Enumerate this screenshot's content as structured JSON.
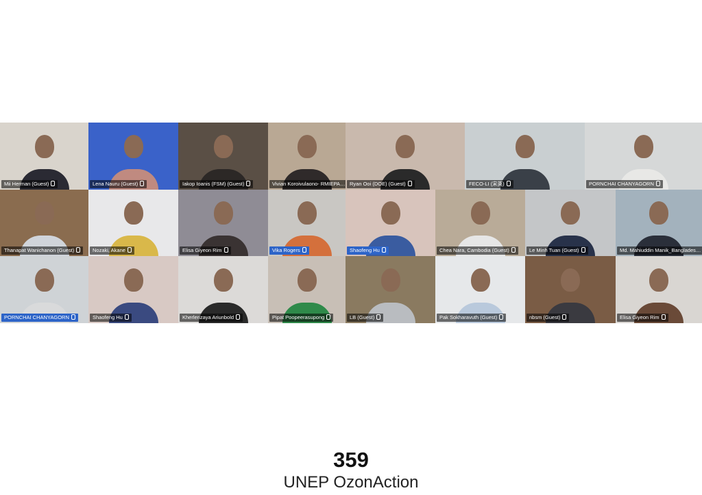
{
  "tiles": [
    {
      "name": "Mii Herman (Guest)",
      "bg": "#d9d4cc",
      "body": "#2a2a33",
      "label": "dark"
    },
    {
      "name": "Lena Nauru (Guest)",
      "bg": "#3a62c9",
      "body": "#c08a80",
      "label": "dark"
    },
    {
      "name": "Iakop Ioanis (FSM) (Guest)",
      "bg": "#5a4f45",
      "body": "#2c2826",
      "label": "dark"
    },
    {
      "name": "Vivian Koroivulaono- RMIEPA",
      "bg": "#b9a894",
      "body": "#2f2a2a",
      "label": "dark"
    },
    {
      "name": "Ryan Ooi (DOE) (Guest)",
      "bg": "#c9b9ad",
      "body": "#2a2a2a",
      "label": "dark"
    },
    {
      "name": "FECO-LI (宋英)",
      "bg": "#c9cfd1",
      "body": "#3a4048",
      "label": "dark"
    },
    {
      "name": "PORNCHAI CHANYAGORN",
      "bg": "#d6d8d8",
      "body": "#e8e8e6",
      "label": "dark"
    },
    {
      "name": "Thanapat Wanichanon (Guest)",
      "bg": "#8a6c4f",
      "body": "#d0d4da",
      "label": "dark"
    },
    {
      "name": "Nozaki, Akane",
      "bg": "#e8e8ea",
      "body": "#d9b84a",
      "label": "dark"
    },
    {
      "name": "Elisa Giyeon Rim",
      "bg": "#8f8c95",
      "body": "#3a3333",
      "label": "dark"
    },
    {
      "name": "Vika Rogers",
      "bg": "#c9c7c3",
      "body": "#d4703c",
      "label": "blue"
    },
    {
      "name": "Shaofeng Hu",
      "bg": "#d8c4bc",
      "body": "#3a5ca0",
      "label": "blue"
    },
    {
      "name": "Chea Nara, Cambodia (Guest)",
      "bg": "#b9ab98",
      "body": "#e6e6e6",
      "label": "dark"
    },
    {
      "name": "Le Minh Tuan (Guest)",
      "bg": "#c4c6c8",
      "body": "#28324a",
      "label": "dark"
    },
    {
      "name": "Md. Mahiuddin Manik_Bangladesh (Gu...",
      "bg": "#a3b2bd",
      "body": "#2a2f3a",
      "label": "dark"
    },
    {
      "name": "PORNCHAI CHANYAGORN",
      "bg": "#cfd3d6",
      "body": "#d9dadb",
      "label": "blue"
    },
    {
      "name": "Shaofeng Hu",
      "bg": "#d8c9c4",
      "body": "#3a4a80",
      "label": "dark"
    },
    {
      "name": "Kherlenzaya Ariunbold",
      "bg": "#dcdad8",
      "body": "#2a2a2a",
      "label": "dark"
    },
    {
      "name": "Pipat Poopeerasupong",
      "bg": "#c8bfb6",
      "body": "#2f8a4a",
      "label": "dark"
    },
    {
      "name": "LB (Guest)",
      "bg": "#8a7a60",
      "body": "#b9bcc0",
      "label": "dark"
    },
    {
      "name": "Pak Sokharavuth (Guest)",
      "bg": "#e6e8ea",
      "body": "#b9c9dc",
      "label": "dark"
    },
    {
      "name": "nbsm (Guest)",
      "bg": "#7a5c45",
      "body": "#3a3a40",
      "label": "dark"
    },
    {
      "name": "Elisa Giyeon Rim",
      "bg": "#d9d6d2",
      "body": "#6a4a38",
      "label": "dark"
    }
  ],
  "footer": {
    "number": "359",
    "org": "UNEP OzonAction"
  }
}
